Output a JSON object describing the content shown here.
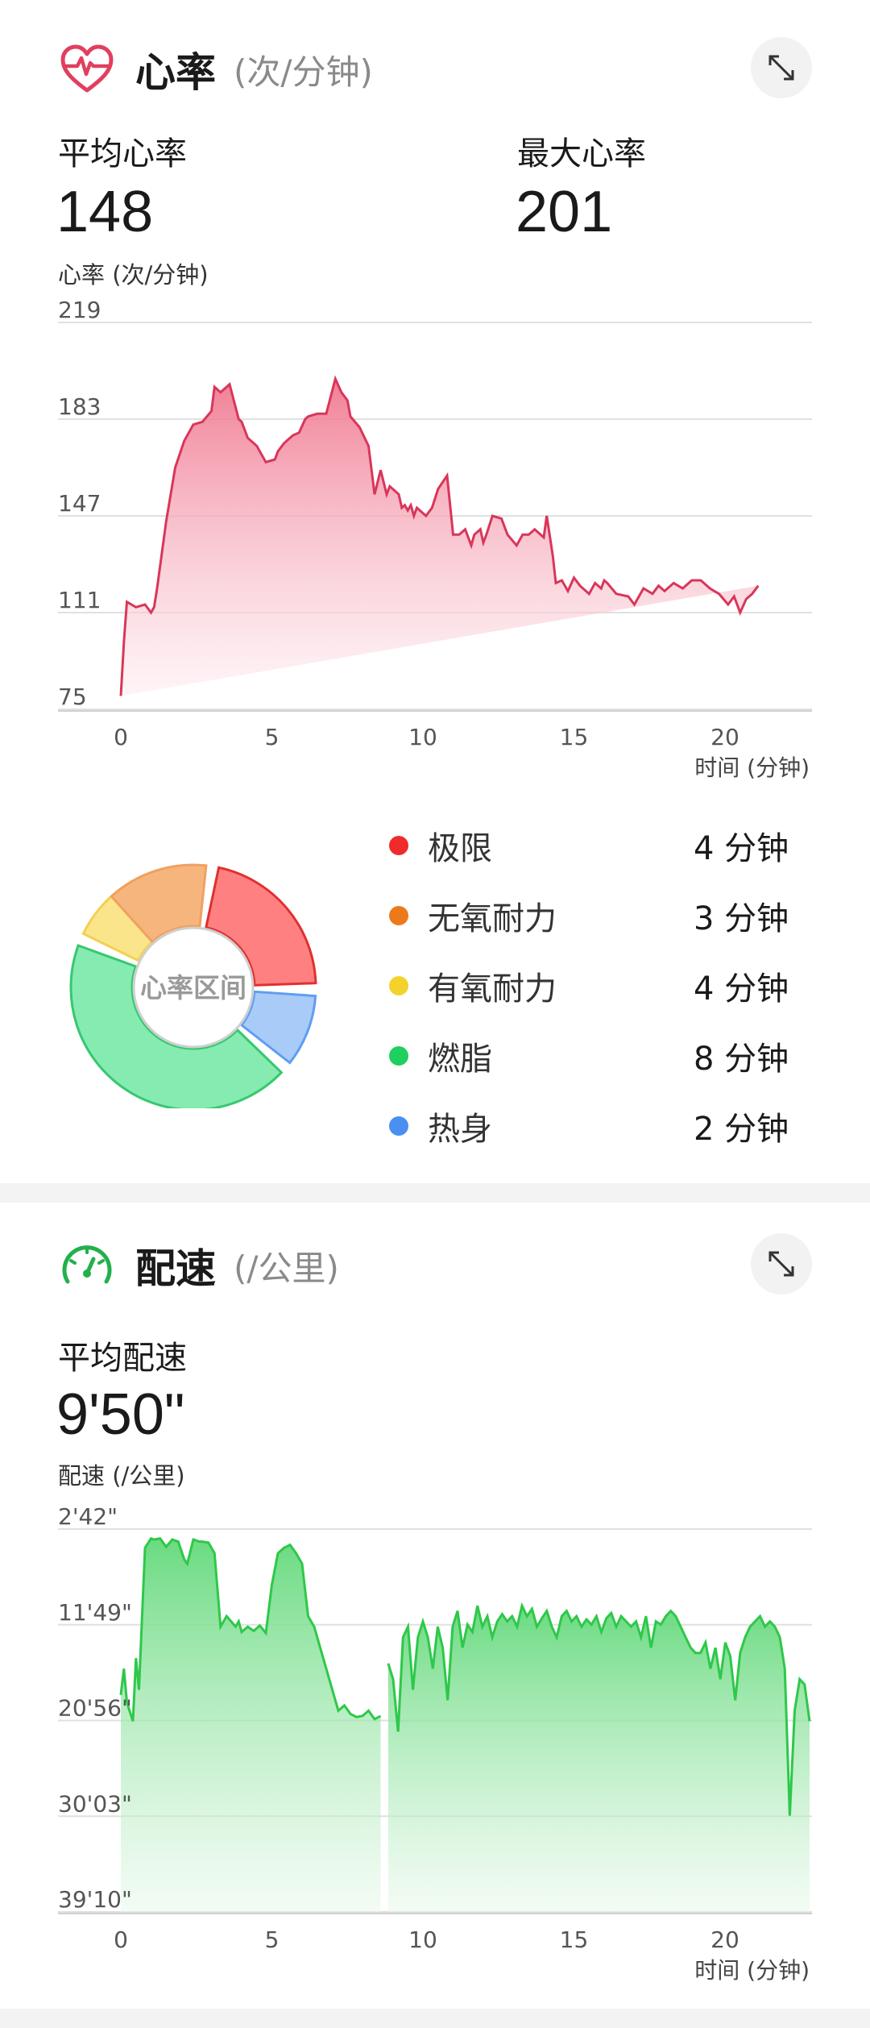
{
  "heart_rate": {
    "title": "心率",
    "unit": "(次/分钟)",
    "avg_label": "平均心率",
    "avg_value": "148",
    "max_label": "最大心率",
    "max_value": "201",
    "chart_subtitle": "心率 (次/分钟)",
    "x_axis_label": "时间 (分钟)",
    "zones_center_label": "心率区间",
    "zones": [
      {
        "name": "极限",
        "value": "4 分钟",
        "color": "#ef2b2b",
        "fill": "#ff8080",
        "stroke": "#e03030"
      },
      {
        "name": "无氧耐力",
        "value": "3 分钟",
        "color": "#ec7a1a",
        "fill": "#f7b57e",
        "stroke": "#f0a060"
      },
      {
        "name": "有氧耐力",
        "value": "4 分钟",
        "color": "#f3d22c",
        "fill": "#fbe58a",
        "stroke": "#f2d050"
      },
      {
        "name": "燃脂",
        "value": "8 分钟",
        "color": "#1fcf5f",
        "fill": "#86ebb0",
        "stroke": "#35c870"
      },
      {
        "name": "热身",
        "value": "2 分钟",
        "color": "#4a90f0",
        "fill": "#a9cbf7",
        "stroke": "#5f9ef0"
      }
    ],
    "icon": "heart-pulse-icon"
  },
  "pace": {
    "title": "配速",
    "unit": "(/公里)",
    "avg_label": "平均配速",
    "avg_value": "9'50\"",
    "chart_subtitle": "配速 (/公里)",
    "x_axis_label": "时间 (分钟)",
    "icon": "speedometer-icon"
  },
  "colors": {
    "heart_line": "#d9365a",
    "heart_fill_top": "#f48aa0",
    "pace_line": "#2ec84a",
    "pace_fill_top": "#7fdf8a",
    "grid": "#dddddd"
  },
  "chart_data": [
    {
      "type": "area",
      "ylabel": "心率 (次/分钟)",
      "xlabel": "时间 (分钟)",
      "xlim": [
        0,
        22.8
      ],
      "ylim": [
        75,
        219
      ],
      "y_ticks": [
        "219",
        "183",
        "147",
        "111",
        "75"
      ],
      "y_tick_values": [
        219,
        183,
        147,
        111,
        75
      ],
      "x_ticks": [
        "0",
        "5",
        "10",
        "15",
        "20"
      ],
      "x_tick_values": [
        0,
        5,
        10,
        15,
        20
      ],
      "grid": true,
      "x": [
        0,
        0.1,
        0.2,
        0.5,
        0.8,
        1.0,
        1.1,
        1.2,
        1.5,
        1.8,
        2.1,
        2.4,
        2.7,
        3.0,
        3.1,
        3.3,
        3.6,
        3.9,
        4.0,
        4.2,
        4.5,
        4.8,
        5.1,
        5.2,
        5.4,
        5.6,
        5.7,
        5.9,
        6.1,
        6.2,
        6.5,
        6.8,
        7.1,
        7.3,
        7.5,
        7.6,
        7.9,
        8.2,
        8.4,
        8.6,
        8.8,
        8.9,
        9.2,
        9.3,
        9.4,
        9.5,
        9.6,
        9.7,
        9.8,
        10.1,
        10.3,
        10.5,
        10.8,
        11.0,
        11.2,
        11.4,
        11.6,
        11.7,
        11.9,
        12.0,
        12.1,
        12.3,
        12.6,
        12.8,
        13.1,
        13.3,
        13.5,
        13.7,
        14.0,
        14.1,
        14.3,
        14.4,
        14.6,
        14.8,
        15.0,
        15.2,
        15.5,
        15.7,
        15.9,
        16.0,
        16.1,
        16.4,
        16.8,
        17.0,
        17.3,
        17.6,
        17.8,
        18.0,
        18.3,
        18.6,
        18.9,
        19.2,
        19.5,
        19.8,
        20.1,
        20.3,
        20.5,
        20.7,
        20.9,
        21.1,
        21.4,
        21.6,
        21.8,
        22.0,
        22.2,
        22.4,
        22.6,
        22.8
      ],
      "y": [
        80,
        100,
        115,
        113,
        114,
        111,
        113,
        120,
        145,
        165,
        175,
        181,
        182,
        186,
        195,
        193,
        196,
        183,
        182,
        176,
        173,
        167,
        168,
        171,
        174,
        176,
        177,
        178,
        183,
        184,
        185,
        185,
        198,
        193,
        190,
        184,
        180,
        173,
        155,
        164,
        155,
        158,
        155,
        150,
        151,
        149,
        151,
        147,
        150,
        147,
        150,
        157,
        162,
        140,
        140,
        142,
        136,
        140,
        142,
        137,
        140,
        147,
        146,
        140,
        136,
        140,
        140,
        142,
        139,
        147,
        132,
        122,
        123,
        119,
        124,
        121,
        118,
        122,
        120,
        123,
        122,
        118,
        117,
        114,
        120,
        118,
        121,
        119,
        122,
        120,
        123,
        123,
        120,
        118,
        114,
        117,
        111,
        116,
        118,
        121
      ]
    },
    {
      "type": "area",
      "ylabel": "配速 (/公里)",
      "xlabel": "时间 (分钟)",
      "xlim": [
        0,
        22.8
      ],
      "ylim": [
        "2'42\"",
        "39'10\""
      ],
      "y_axis_inverted": true,
      "y_ticks": [
        "2'42\"",
        "11'49\"",
        "20'56\"",
        "30'03\"",
        "39'10\""
      ],
      "x_ticks": [
        "0",
        "5",
        "10",
        "15",
        "20"
      ],
      "x_tick_values": [
        0,
        5,
        10,
        15,
        20
      ],
      "grid": true,
      "gap": [
        8.65,
        8.85
      ],
      "x_unit_note": "y values in minutes per km",
      "x": [
        0,
        0.1,
        0.2,
        0.4,
        0.5,
        0.6,
        0.8,
        1.0,
        1.1,
        1.3,
        1.5,
        1.7,
        1.9,
        2.1,
        2.2,
        2.4,
        2.6,
        2.7,
        2.9,
        3.1,
        3.3,
        3.5,
        3.8,
        3.9,
        4.0,
        4.2,
        4.4,
        4.6,
        4.8,
        5.0,
        5.2,
        5.4,
        5.6,
        5.8,
        6.0,
        6.2,
        6.4,
        6.6,
        6.8,
        7.0,
        7.2,
        7.4,
        7.6,
        7.8,
        8.0,
        8.2,
        8.4,
        8.6
      ],
      "y": [
        18.5,
        16.0,
        19.2,
        21.0,
        15.0,
        18.0,
        4.5,
        3.6,
        3.7,
        3.6,
        4.4,
        3.7,
        3.9,
        5.6,
        6.0,
        3.7,
        3.9,
        3.9,
        4.0,
        5.0,
        12.0,
        11.0,
        12.0,
        11.5,
        12.5,
        12.0,
        12.4,
        11.9,
        12.6,
        8.0,
        5.0,
        4.5,
        4.2,
        5.0,
        6.0,
        11.0,
        12.0,
        14.0,
        16.0,
        18.0,
        20.0,
        19.5,
        20.3,
        20.6,
        20.5,
        20.0,
        20.8,
        20.5
      ]
    }
  ]
}
